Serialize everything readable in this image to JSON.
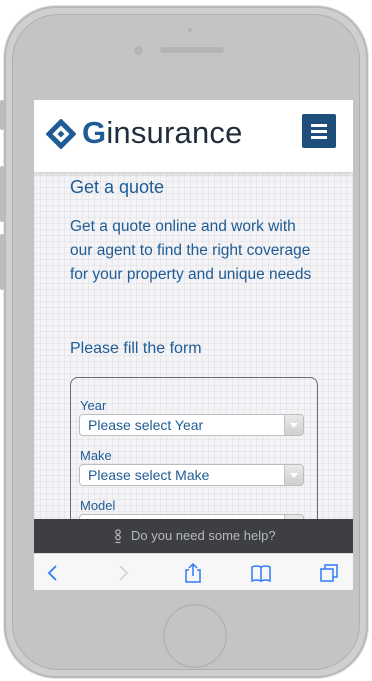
{
  "brand": {
    "mark": "G",
    "name_rest": "insurance",
    "accent": "#1f5c95",
    "dark": "#1e4e7c"
  },
  "header": {
    "menu_icon": "hamburger-menu-icon"
  },
  "main": {
    "title": "Get a quote",
    "intro": "Get a quote online and work with our agent to find the right coverage for your property and unique needs",
    "fill_prompt": "Please fill the form"
  },
  "form": {
    "fields": [
      {
        "label": "Year",
        "value": "Please select Year"
      },
      {
        "label": "Make",
        "value": "Please select Make"
      },
      {
        "label": "Model",
        "value": ""
      }
    ]
  },
  "help": {
    "text": "Do you need some help?"
  },
  "browser_toolbar": [
    "back-icon",
    "forward-icon",
    "share-icon",
    "bookmarks-icon",
    "tabs-icon"
  ]
}
